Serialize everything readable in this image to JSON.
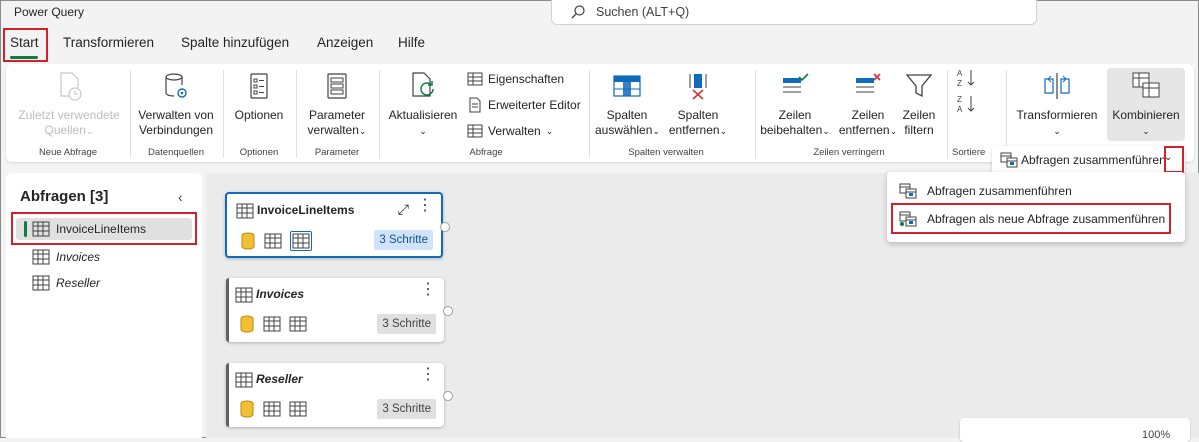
{
  "app": {
    "title": "Power Query"
  },
  "search": {
    "placeholder": "Suchen (ALT+Q)"
  },
  "tabs": [
    {
      "label": "Start",
      "active": true
    },
    {
      "label": "Transformieren"
    },
    {
      "label": "Spalte hinzufügen"
    },
    {
      "label": "Anzeigen"
    },
    {
      "label": "Hilfe"
    }
  ],
  "ribbon": {
    "groups": {
      "neue_abfrage": "Neue Abfrage",
      "datenquellen": "Datenquellen",
      "optionen": "Optionen",
      "parameter": "Parameter",
      "abfrage": "Abfrage",
      "spalten_verwalten": "Spalten verwalten",
      "zeilen_verringern": "Zeilen verringern",
      "sortieren": "Sortiere"
    },
    "buttons": {
      "recent_line1": "Zuletzt verwendete",
      "recent_line2": "Quellen",
      "connections_line1": "Verwalten von",
      "connections_line2": "Verbindungen",
      "options": "Optionen",
      "params_line1": "Parameter",
      "params_line2": "verwalten",
      "refresh": "Aktualisieren",
      "properties": "Eigenschaften",
      "advanced_editor": "Erweiterter Editor",
      "manage": "Verwalten",
      "choose_cols_line1": "Spalten",
      "choose_cols_line2": "auswählen",
      "remove_cols_line1": "Spalten",
      "remove_cols_line2": "entfernen",
      "keep_rows_line1": "Zeilen",
      "keep_rows_line2": "beibehalten",
      "remove_rows_line1": "Zeilen",
      "remove_rows_line2": "entfernen",
      "filter_rows_line1": "Zeilen",
      "filter_rows_line2": "filtern",
      "transform": "Transformieren",
      "combine": "Kombinieren"
    }
  },
  "queries_pane": {
    "title": "Abfragen [3]",
    "items": [
      {
        "label": "InvoiceLineItems",
        "selected": true
      },
      {
        "label": "Invoices"
      },
      {
        "label": "Reseller"
      }
    ]
  },
  "cards": [
    {
      "title": "InvoiceLineItems",
      "steps": "3 Schritte",
      "selected": true
    },
    {
      "title": "Invoices",
      "steps": "3 Schritte"
    },
    {
      "title": "Reseller",
      "steps": "3 Schritte"
    }
  ],
  "merge": {
    "split_label": "Abfragen zusammenführen",
    "menu": [
      {
        "label": "Abfragen zusammenführen"
      },
      {
        "label": "Abfragen als neue Abfrage zusammenführen",
        "highlighted": true
      }
    ]
  },
  "zoom": {
    "value": "100%"
  },
  "colors": {
    "accent": "#107c41",
    "selection": "#0f6cbd",
    "highlight_box": "#d1212c"
  }
}
